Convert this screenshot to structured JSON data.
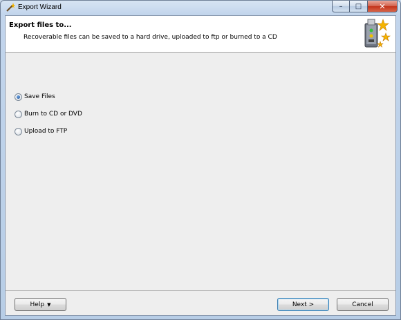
{
  "window": {
    "title": "Export Wizard",
    "icon": "wand-icon",
    "controls": {
      "minimize": "–",
      "maximize": "□",
      "close": "✕"
    }
  },
  "header": {
    "title": "Export files to...",
    "subtitle": "Recoverable files can be saved to a hard drive, uploaded to ftp or burned to a CD",
    "icon": "usb-drive-stars-icon"
  },
  "options": [
    {
      "label": "Save Files",
      "checked": true
    },
    {
      "label": "Burn to CD or DVD",
      "checked": false
    },
    {
      "label": "Upload to FTP",
      "checked": false
    }
  ],
  "footer": {
    "help_label": "Help",
    "next_label": "Next >",
    "cancel_label": "Cancel"
  },
  "colors": {
    "accent": "#3c7fb1",
    "close_button": "#c2321a"
  }
}
